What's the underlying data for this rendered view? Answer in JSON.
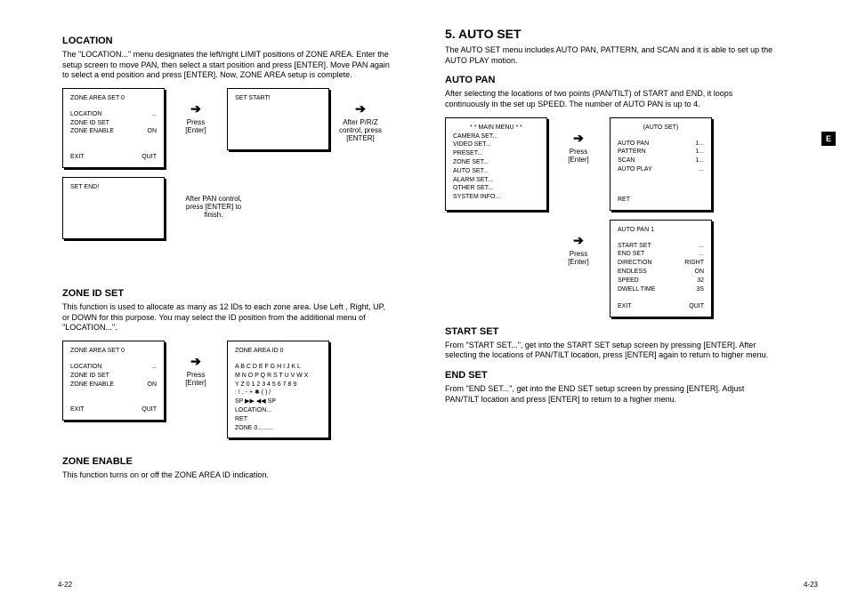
{
  "sideTab": "E",
  "pageLeft": "4-22",
  "pageRight": "4-23",
  "left": {
    "location": {
      "heading": "LOCATION",
      "text": "The \"LOCATION...\" menu designates the left/right LIMIT positions of ZONE AREA. Enter the setup screen to move PAN, then select a start position and press [ENTER]. Move PAN again to select a end position and press [ENTER].  Now, ZONE AREA setup is complete.",
      "box1": {
        "title": "ZONE AREA SET   0",
        "r1a": "LOCATION",
        "r1b": "...",
        "r2a": "ZONE ID SET",
        "r2b": "",
        "r3a": "ZONE ENABLE",
        "r3b": "ON",
        "fa": "EXIT",
        "fb": "QUIT"
      },
      "arrow1": {
        "t1": "Press",
        "t2": "[Enter]"
      },
      "box2": {
        "title": "SET START!"
      },
      "arrow2": {
        "t1": "After P/R/Z",
        "t2": "control, press",
        "t3": "[ENTER]"
      },
      "box3": {
        "title": "SET END!"
      },
      "arrow3": {
        "t1": "After PAN control,",
        "t2": "press [ENTER] to",
        "t3": "finish."
      }
    },
    "zoneId": {
      "heading": "ZONE ID SET",
      "text": "This function is used to allocate as many as 12 IDs to each zone area.  Use Left , Right, UP, or DOWN for this purpose. You may select the ID position from the additional menu  of \"LOCATION...\".",
      "box1": {
        "title": "ZONE AREA SET   0",
        "r1a": "LOCATION",
        "r1b": "...",
        "r2a": "ZONE ID SET",
        "r2b": "",
        "r3a": "ZONE ENABLE",
        "r3b": "ON",
        "fa": "EXIT",
        "fb": "QUIT"
      },
      "arrow1": {
        "t1": "Press",
        "t2": "[Enter]"
      },
      "box2": {
        "title": "ZONE AREA ID 0",
        "l1": "A  B C D E F G H I  J  K  L",
        "l2": "M N O P Q R S T U V W X",
        "l3": "Y Z 0 1 2 3 4 5 6 7 8  9",
        "l4": ":  !   .  -  +  ✱ (  ) /",
        "l5": "SP ▶▶ ◀◀ SP",
        "l6": "LOCATION...",
        "l7": "RET",
        "l8": "ZONE  0........."
      }
    },
    "zoneEnable": {
      "heading": "ZONE ENABLE",
      "text": "This function turns on or off the ZONE AREA ID indication."
    }
  },
  "right": {
    "autoSet": {
      "heading": "5. AUTO SET",
      "text": "The AUTO SET menu includes AUTO PAN, PATTERN, and SCAN and it is able to set up the AUTO PLAY motion."
    },
    "autoPan": {
      "heading": "AUTO PAN",
      "text": "After selecting the locations of two points (PAN/TILT) of START and END, it loops continuously in the set up SPEED. The number of AUTO PAN is up to 4.",
      "box1": {
        "title": "* *  MAIN MENU * *",
        "l1": "CAMERA SET...",
        "l2": "VIDEO SET...",
        "l3": "PRESET...",
        "l4": "ZONE SET...",
        "l5": "AUTO SET...",
        "l6": "ALARM SET...",
        "l7": "OTHER SET...",
        "l8": "SYSTEM INFO..."
      },
      "arrow1": {
        "t1": "Press",
        "t2": "[Enter]"
      },
      "box2": {
        "title": "(AUTO SET)",
        "r1a": "AUTO PAN",
        "r1b": "1...",
        "r2a": "PATTERN",
        "r2b": "1...",
        "r3a": "SCAN",
        "r3b": "1...",
        "r4a": "AUTO PLAY",
        "r4b": "...",
        "fa": "RET"
      },
      "arrow2": {
        "t1": "Press",
        "t2": "[Enter]"
      },
      "box3": {
        "title": "AUTO PAN   1",
        "r1a": "START SET",
        "r1b": "...",
        "r2a": "END SET",
        "r2b": "...",
        "r3a": "DIRECTION",
        "r3b": "RIGHT",
        "r4a": "ENDLESS",
        "r4b": "ON",
        "r5a": "SPEED",
        "r5b": "32",
        "r6a": "DWELL TIME",
        "r6b": "3S",
        "fa": "EXIT",
        "fb": "QUIT"
      }
    },
    "startSet": {
      "heading": "START SET",
      "text": "From \"START SET...\", get into the START SET setup screen by pressing [ENTER]. After selecting the locations of PAN/TILT location, press [ENTER] again to return to higher menu."
    },
    "endSet": {
      "heading": "END SET",
      "text": "From \"END SET...\", get into the END SET setup screen by pressing [ENTER].  Adjust PAN/TILT location and press [ENTER] to return to a higher menu."
    }
  }
}
